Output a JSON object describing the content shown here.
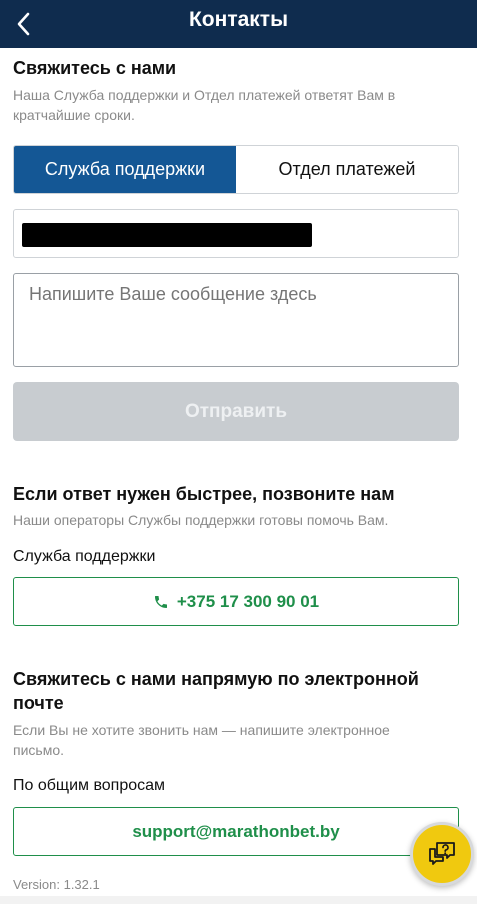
{
  "header": {
    "title": "Контакты",
    "back_icon": "chevron-left-icon"
  },
  "contact_form": {
    "title": "Свяжитесь с нами",
    "subtitle_line1": "Наша Служба поддержки и Отдел платежей ответят Вам в",
    "subtitle_line2": "кратчайшие сроки.",
    "tabs": [
      {
        "label": "Служба поддержки",
        "active": true
      },
      {
        "label": "Отдел платежей",
        "active": false
      }
    ],
    "email_value": "",
    "message_placeholder": "Напишите Ваше сообщение здесь",
    "send_label": "Отправить"
  },
  "call_section": {
    "title": "Если ответ нужен быстрее, позвоните нам",
    "subtitle": "Наши операторы Службы поддержки готовы помочь Вам.",
    "label": "Служба поддержки",
    "phone": "+375 17 300 90 01"
  },
  "email_section": {
    "title_line1": "Свяжитесь с нами напрямую по электронной",
    "title_line2": "почте",
    "subtitle_line1": "Если Вы не хотите звонить нам — напишите электронное",
    "subtitle_line2": "письмо.",
    "label": "По общим вопросам",
    "email": "support@marathonbet.by"
  },
  "footer": {
    "version": "Version: 1.32.1"
  },
  "colors": {
    "header_bg": "#0f2c4e",
    "active_tab": "#145795",
    "accent_green": "#1f8f4a",
    "fab_yellow": "#f0c90f"
  }
}
